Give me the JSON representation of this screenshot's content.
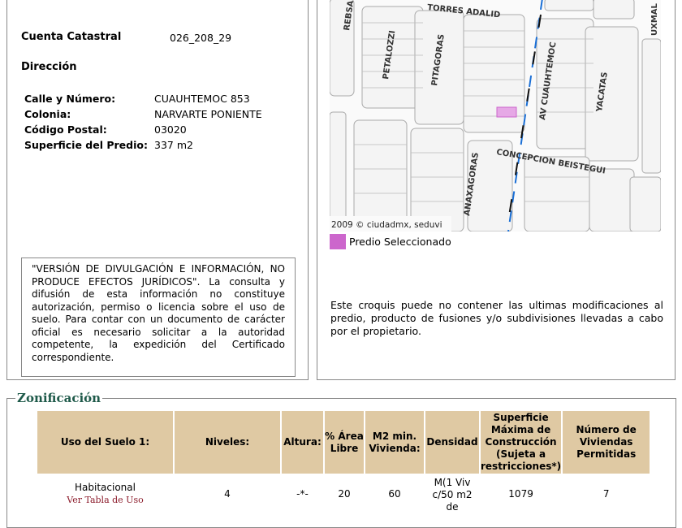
{
  "cuenta": {
    "label": "Cuenta Catastral",
    "value": "026_208_29"
  },
  "direccion_label": "Dirección",
  "address": [
    {
      "k": "Calle y Número:",
      "v": "CUAUHTEMOC 853"
    },
    {
      "k": "Colonia:",
      "v": "NARVARTE PONIENTE"
    },
    {
      "k": "Código Postal:",
      "v": "03020"
    },
    {
      "k": "Superficie del Predio:",
      "v": "337 m2"
    }
  ],
  "disclaimer": "\"VERSIÓN DE DIVULGACIÓN E INFORMACIÓN, NO PRODUCE EFECTOS JURÍDICOS\". La consulta y difusión de esta información no constituye autorización, permiso o licencia sobre el uso de suelo. Para contar con un documento de carácter oficial es necesario solicitar a la autoridad competente, la expedición del Certificado correspondiente.",
  "map": {
    "streets": [
      "TORRES ADALID",
      "REBSA",
      "PETALOZZI",
      "PITAGORAS",
      "AV CUAUHTEMOC",
      "YACATAS",
      "UXMAL",
      "CONCEPCION BEISTEGUI",
      "ANAXAGORAS"
    ],
    "credit": "2009 © ciudadmx, seduvi",
    "highlight_color": "#cc66cc"
  },
  "legend": "Predio Seleccionado",
  "note": "Este croquis puede no contener las ultimas modificaciones al predio, producto de fusiones y/o subdivisiones llevadas a cabo por el propietario.",
  "zonificacion": {
    "title": "Zonificación",
    "headers": [
      "Uso del Suelo 1:",
      "Niveles:",
      "Altura:",
      "% Área Libre",
      "M2 min. Vivienda:",
      "Densidad",
      "Superficie Máxima de Construcción (Sujeta a restricciones*)",
      "Número de Viviendas Permitidas"
    ],
    "row": {
      "uso": "Habitacional",
      "link": "Ver Tabla de Uso",
      "niveles": "4",
      "altura": "-*-",
      "area_libre": "20",
      "m2": "60",
      "densidad": "M(1 Viv c/50 m2 de",
      "superficie": "1079",
      "viviendas": "7"
    }
  }
}
